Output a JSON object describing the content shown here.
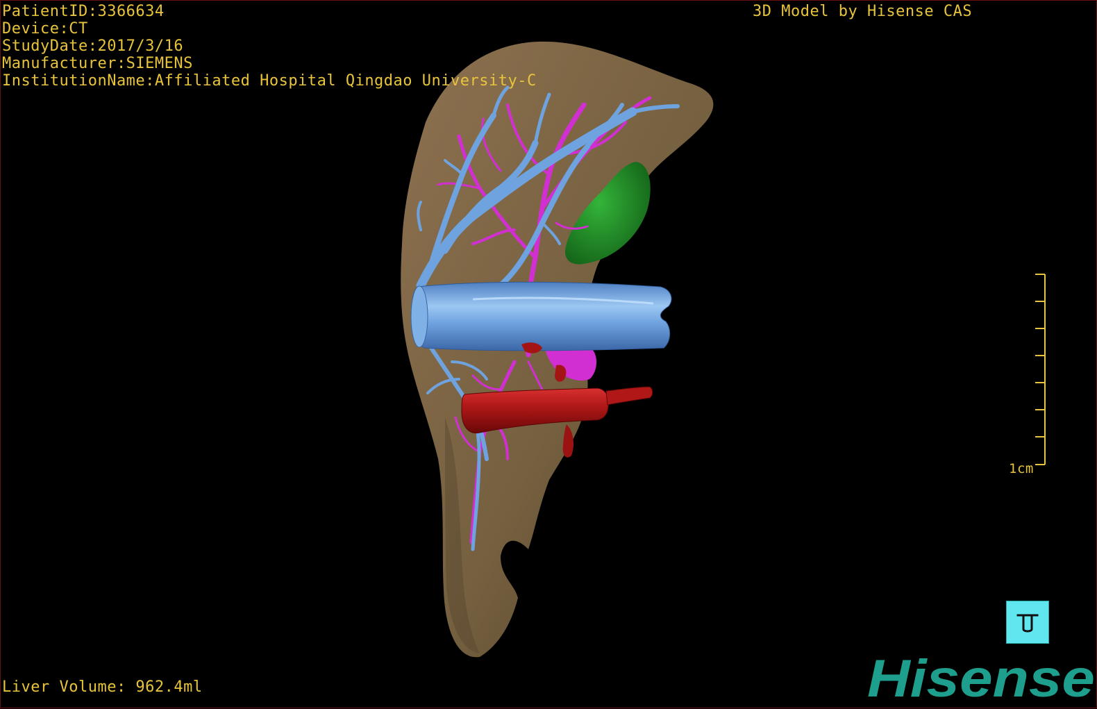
{
  "patient_info": {
    "patient_id": "PatientID:3366634",
    "device": "Device:CT",
    "study_date": "StudyDate:2017/3/16",
    "manufacturer": "Manufacturer:SIEMENS",
    "institution": "InstitutionName:Affiliated Hospital Qingdao University-C"
  },
  "brand_caption": "3D Model by Hisense CAS",
  "volume_label": "Liver Volume: 962.4ml",
  "scale_bar": {
    "label": "1cm"
  },
  "logo": {
    "text": "Hisense",
    "color": "#1e9e8c"
  },
  "colors": {
    "overlay_text": "#e8c43c",
    "liver": "#7a6244",
    "hepatic_vein": "#6fa3df",
    "portal_vein": "#d22fd2",
    "artery": "#b01818",
    "gallbladder": "#1f8a24",
    "orientation_button": "#5fe6ee",
    "background": "#000000"
  },
  "orientation_icon": "view-orientation-icon"
}
